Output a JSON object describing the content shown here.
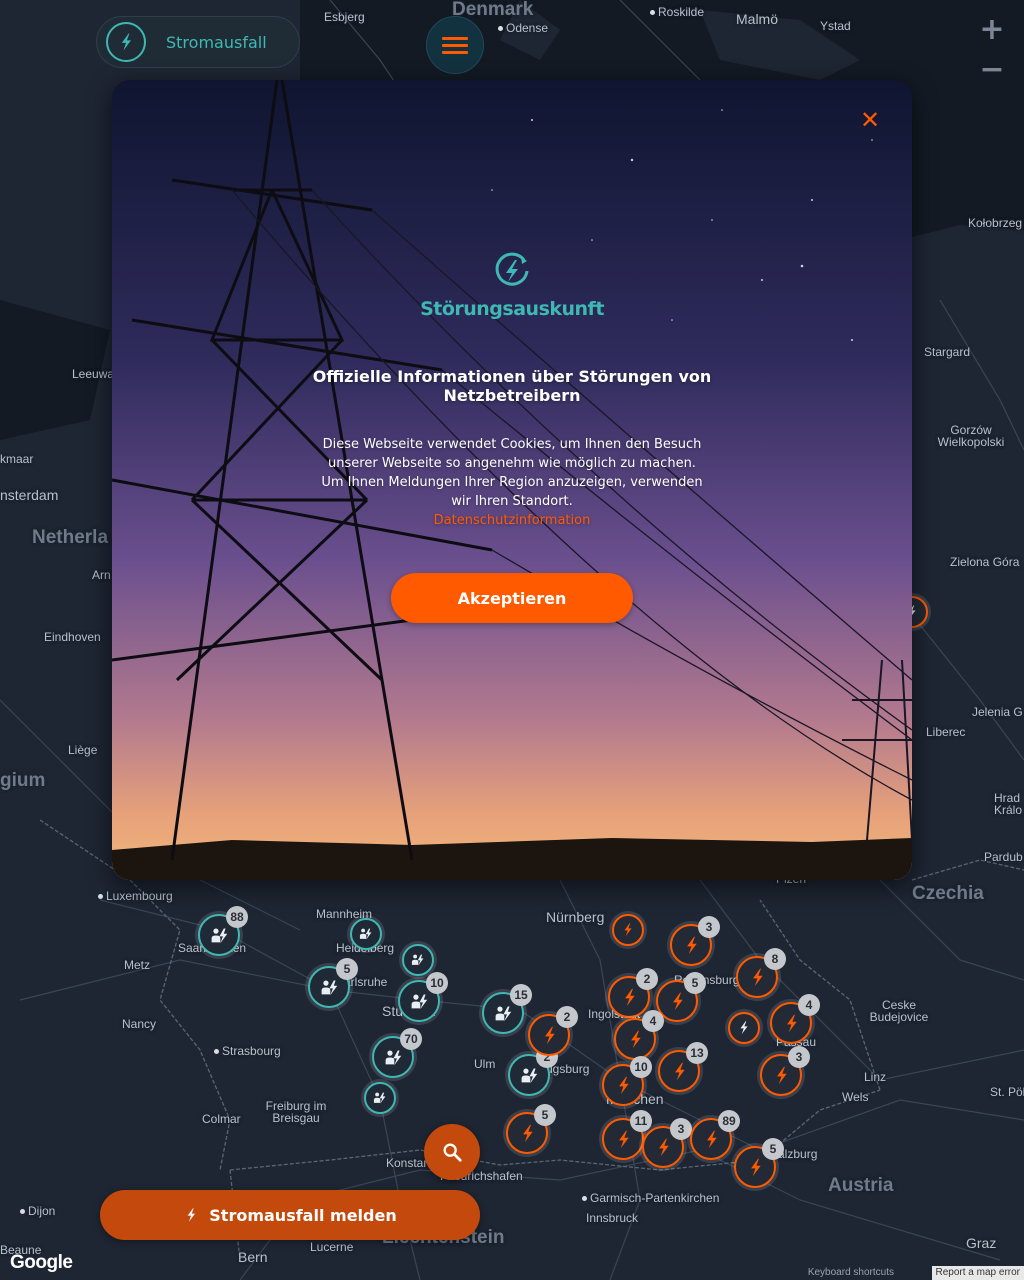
{
  "header": {
    "brand_label": "Stromausfall"
  },
  "map": {
    "zoom_in": "+",
    "zoom_out": "−",
    "google": "Google",
    "keyboard_shortcuts": "Keyboard shortcuts",
    "report_error": "Report a map error",
    "labels": [
      {
        "text": "Denmark",
        "kind": "big"
      },
      {
        "text": "Esbjerg",
        "kind": "small"
      },
      {
        "text": "Odense",
        "kind": "small"
      },
      {
        "text": "Roskilde",
        "kind": "small"
      },
      {
        "text": "Malmö",
        "kind": "mid"
      },
      {
        "text": "Ystad",
        "kind": "small"
      },
      {
        "text": "Kołobrzeg",
        "kind": "small"
      },
      {
        "text": "Stargard",
        "kind": "small"
      },
      {
        "text": "Gorzów Wielkopolski",
        "kind": "small"
      },
      {
        "text": "Zielona Góra",
        "kind": "small"
      },
      {
        "text": "Jelenia G",
        "kind": "small"
      },
      {
        "text": "Liberec",
        "kind": "small"
      },
      {
        "text": "Hrad Králo",
        "kind": "small"
      },
      {
        "text": "Pardub",
        "kind": "small"
      },
      {
        "text": "Czechia",
        "kind": "big"
      },
      {
        "text": "Plzeň",
        "kind": "small"
      },
      {
        "text": "Leeuwa",
        "kind": "small"
      },
      {
        "text": "kmaar",
        "kind": "small"
      },
      {
        "text": "nsterdam",
        "kind": "mid"
      },
      {
        "text": "Netherla",
        "kind": "big"
      },
      {
        "text": "Arn",
        "kind": "small"
      },
      {
        "text": "Eindhoven",
        "kind": "small"
      },
      {
        "text": "Liège",
        "kind": "small"
      },
      {
        "text": "gium",
        "kind": "big"
      },
      {
        "text": "Luxembourg",
        "kind": "small"
      },
      {
        "text": "Mannheim",
        "kind": "small"
      },
      {
        "text": "Heidelberg",
        "kind": "small"
      },
      {
        "text": "Metz",
        "kind": "small"
      },
      {
        "text": "Nancy",
        "kind": "small"
      },
      {
        "text": "Strasbourg",
        "kind": "small"
      },
      {
        "text": "Freiburg im Breisgau",
        "kind": "small"
      },
      {
        "text": "Colmar",
        "kind": "small"
      },
      {
        "text": "Dijon",
        "kind": "small"
      },
      {
        "text": "Beaune",
        "kind": "small"
      },
      {
        "text": "Bern",
        "kind": "mid"
      },
      {
        "text": "Lucerne",
        "kind": "small"
      },
      {
        "text": "Liechtenstein",
        "kind": "big"
      },
      {
        "text": "Konstanz",
        "kind": "small"
      },
      {
        "text": "Friedrichshafen",
        "kind": "small"
      },
      {
        "text": "Garmisch-Partenkirchen",
        "kind": "small"
      },
      {
        "text": "Innsbruck",
        "kind": "small"
      },
      {
        "text": "Austria",
        "kind": "big"
      },
      {
        "text": "Salzburg",
        "kind": "small"
      },
      {
        "text": "Linz",
        "kind": "small"
      },
      {
        "text": "Wels",
        "kind": "small"
      },
      {
        "text": "St. Pölten",
        "kind": "small"
      },
      {
        "text": "Graz",
        "kind": "mid"
      },
      {
        "text": "Ceske Budejovice",
        "kind": "small"
      },
      {
        "text": "Passau",
        "kind": "small"
      },
      {
        "text": "Nürnberg",
        "kind": "mid"
      },
      {
        "text": "Ingolstadt",
        "kind": "small"
      },
      {
        "text": "Augsburg",
        "kind": "small"
      },
      {
        "text": "Ulm",
        "kind": "small"
      },
      {
        "text": "Stuttgart",
        "kind": "mid"
      },
      {
        "text": "Karlsruhe",
        "kind": "small"
      },
      {
        "text": "Saarbrücken",
        "kind": "small"
      },
      {
        "text": "München",
        "kind": "mid"
      },
      {
        "text": "Regensburg",
        "kind": "small"
      }
    ],
    "markers": [
      {
        "type": "teal",
        "count": "88"
      },
      {
        "type": "teal",
        "count": ""
      },
      {
        "type": "teal",
        "count": "5"
      },
      {
        "type": "teal",
        "count": ""
      },
      {
        "type": "teal",
        "count": "10"
      },
      {
        "type": "teal",
        "count": "70"
      },
      {
        "type": "teal",
        "count": ""
      },
      {
        "type": "teal",
        "count": "15"
      },
      {
        "type": "teal",
        "count": "2"
      },
      {
        "type": "orange",
        "count": "2"
      },
      {
        "type": "orange",
        "count": "2"
      },
      {
        "type": "orange",
        "count": "5"
      },
      {
        "type": "orange",
        "count": "4"
      },
      {
        "type": "orange",
        "count": "3"
      },
      {
        "type": "orange",
        "count": "8"
      },
      {
        "type": "orange",
        "count": "4"
      },
      {
        "type": "orange",
        "count": "10"
      },
      {
        "type": "orange",
        "count": "13"
      },
      {
        "type": "orange",
        "count": "3"
      },
      {
        "type": "orange",
        "count": "5"
      },
      {
        "type": "orange",
        "count": "11"
      },
      {
        "type": "orange",
        "count": "3"
      },
      {
        "type": "orange",
        "count": "89"
      },
      {
        "type": "orange",
        "count": "5"
      },
      {
        "type": "orange",
        "count": ""
      },
      {
        "type": "orange",
        "count": ""
      },
      {
        "type": "orange",
        "count": ""
      }
    ]
  },
  "modal": {
    "logo_text": "Störungsauskunft",
    "heading": "Offizielle Informationen über Störungen von Netzbetreibern",
    "body": "Diese Webseite verwendet Cookies, um Ihnen den Besuch unserer Webseite so angenehm wie möglich zu machen. Um Ihnen Meldungen Ihrer Region anzuzeigen, verwenden wir Ihren Standort.",
    "privacy_link": "Datenschutzinformation",
    "accept_label": "Akzeptieren",
    "close_symbol": "✕"
  },
  "actions": {
    "report_label": "Stromausfall melden"
  },
  "colors": {
    "accent": "#ff5a00",
    "teal": "#3fb8b4",
    "map_bg": "#1e2633"
  }
}
